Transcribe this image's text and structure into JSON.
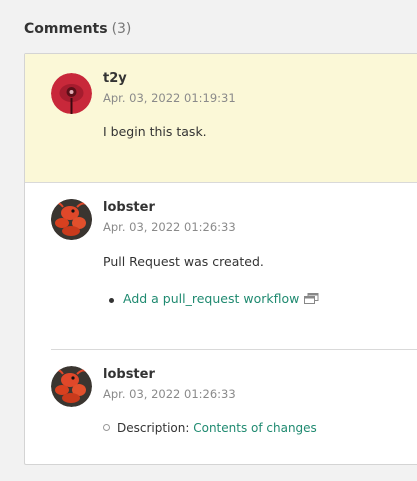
{
  "section": {
    "title": "Comments",
    "count": "(3)"
  },
  "colors": {
    "highlight": "#fbf8d7",
    "link": "#1f8a70"
  },
  "comments": [
    {
      "author": "t2y",
      "time": "Apr. 03, 2022 01:19:31",
      "text": "I begin this task.",
      "avatar_icon": "red-flower-avatar"
    },
    {
      "author": "lobster",
      "time": "Apr. 03, 2022 01:26:33",
      "text": "Pull Request was created.",
      "link_label": "Add a pull_request workflow",
      "link_icon": "external-window-icon",
      "avatar_icon": "red-lobster-avatar"
    },
    {
      "author": "lobster",
      "time": "Apr. 03, 2022 01:26:33",
      "field_label": "Description:",
      "field_link": "Contents of changes",
      "avatar_icon": "red-lobster-avatar"
    }
  ]
}
